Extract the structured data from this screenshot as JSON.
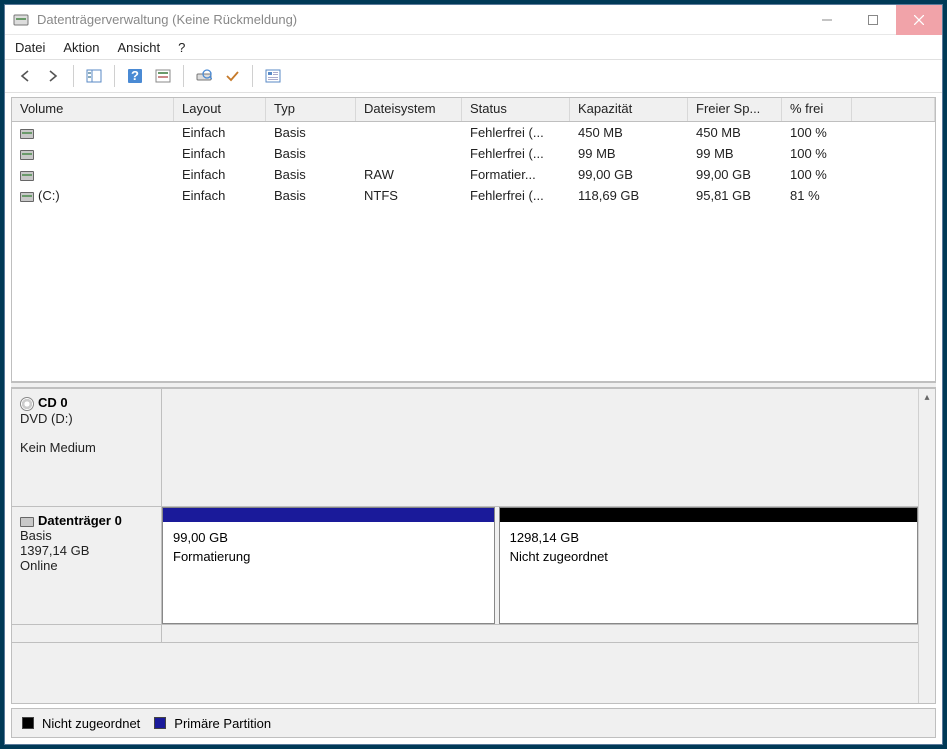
{
  "window": {
    "title": "Datenträgerverwaltung (Keine Rückmeldung)"
  },
  "menu": {
    "datei": "Datei",
    "aktion": "Aktion",
    "ansicht": "Ansicht",
    "hilfe": "?"
  },
  "columns": {
    "volume": "Volume",
    "layout": "Layout",
    "typ": "Typ",
    "fs": "Dateisystem",
    "status": "Status",
    "kap": "Kapazität",
    "frei": "Freier Sp...",
    "pct": "% frei"
  },
  "volumes": [
    {
      "name": "",
      "layout": "Einfach",
      "typ": "Basis",
      "fs": "",
      "status": "Fehlerfrei (...",
      "kap": "450 MB",
      "frei": "450 MB",
      "pct": "100 %"
    },
    {
      "name": "",
      "layout": "Einfach",
      "typ": "Basis",
      "fs": "",
      "status": "Fehlerfrei (...",
      "kap": "99 MB",
      "frei": "99 MB",
      "pct": "100 %"
    },
    {
      "name": "",
      "layout": "Einfach",
      "typ": "Basis",
      "fs": "RAW",
      "status": "Formatier...",
      "kap": "99,00 GB",
      "frei": "99,00 GB",
      "pct": "100 %"
    },
    {
      "name": "(C:)",
      "layout": "Einfach",
      "typ": "Basis",
      "fs": "NTFS",
      "status": "Fehlerfrei (...",
      "kap": "118,69 GB",
      "frei": "95,81 GB",
      "pct": "81 %"
    }
  ],
  "cd": {
    "title": "CD 0",
    "drive": "DVD (D:)",
    "empty": "Kein Medium"
  },
  "disk0": {
    "title": "Datenträger 0",
    "type": "Basis",
    "size": "1397,14 GB",
    "state": "Online",
    "part1": {
      "size": "99,00 GB",
      "status": "Formatierung",
      "stripe": "#1a1a9a"
    },
    "part2": {
      "size": "1298,14 GB",
      "status": "Nicht zugeordnet",
      "stripe": "#000000"
    }
  },
  "legend": {
    "unalloc": "Nicht zugeordnet",
    "primary": "Primäre Partition",
    "c_unalloc": "#000000",
    "c_primary": "#1a1a9a"
  }
}
